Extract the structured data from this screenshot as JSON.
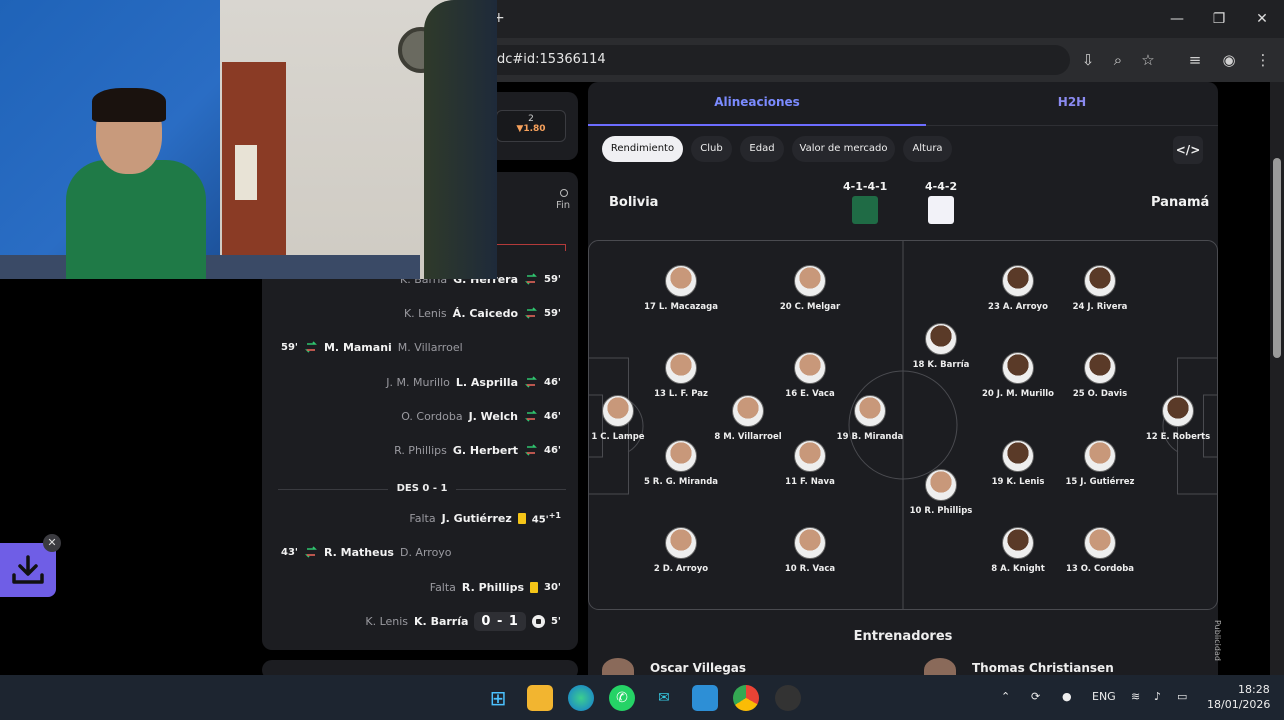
{
  "browser": {
    "url": "dc#id:15366114",
    "window_controls": [
      "minimize-icon",
      "maximize-icon",
      "close-icon"
    ],
    "new_tab": "+"
  },
  "match": {
    "odds_label": "2",
    "odds_value": "▼1.80",
    "fin_label": "Fin",
    "halftime_label": "DES 0 - 1",
    "score": "0 - 1"
  },
  "timeline": [
    {
      "side": "right",
      "secondary": "K. Barría",
      "main": "G. Herrera",
      "type": "sub",
      "minute": "59'"
    },
    {
      "side": "right",
      "secondary": "K. Lenis",
      "main": "Á. Caicedo",
      "type": "sub",
      "minute": "59'"
    },
    {
      "side": "left",
      "secondary": "M. Villarroel",
      "main": "M. Mamani",
      "type": "sub",
      "minute": "59'"
    },
    {
      "side": "right",
      "secondary": "J. M. Murillo",
      "main": "L. Asprilla",
      "type": "sub",
      "minute": "46'"
    },
    {
      "side": "right",
      "secondary": "O. Cordoba",
      "main": "J. Welch",
      "type": "sub",
      "minute": "46'"
    },
    {
      "side": "right",
      "secondary": "R. Phillips",
      "main": "G. Herbert",
      "type": "sub",
      "minute": "46'"
    },
    {
      "side": "right",
      "secondary": "Falta",
      "main": "J. Gutiérrez",
      "type": "yellow",
      "minute": "45'",
      "added": "+1"
    },
    {
      "side": "left",
      "secondary": "D. Arroyo",
      "main": "R. Matheus",
      "type": "sub",
      "minute": "43'"
    },
    {
      "side": "right",
      "secondary": "Falta",
      "main": "R. Phillips",
      "type": "yellow",
      "minute": "30'"
    },
    {
      "side": "right",
      "secondary": "K. Lenis",
      "main": "K. Barría",
      "type": "goal",
      "minute": "5'"
    }
  ],
  "lineup": {
    "tabs": [
      "Alineaciones",
      "H2H"
    ],
    "filters": [
      "Rendimiento",
      "Club",
      "Edad",
      "Valor de mercado",
      "Altura"
    ],
    "embed_icon": "</>",
    "home": {
      "name": "Bolivia",
      "formation": "4-1-4-1",
      "kit_color": "#1f6b45"
    },
    "away": {
      "name": "Panamá",
      "formation": "4-4-2",
      "kit_color": "#f2f2f8"
    },
    "home_players": [
      {
        "label": "1 C. Lampe"
      },
      {
        "label": "17 L. Macazaga"
      },
      {
        "label": "13 L. F. Paz"
      },
      {
        "label": "5 R. G. Miranda"
      },
      {
        "label": "2 D. Arroyo"
      },
      {
        "label": "8 M. Villarroel"
      },
      {
        "label": "20 C. Melgar"
      },
      {
        "label": "16 E. Vaca"
      },
      {
        "label": "11 F. Nava"
      },
      {
        "label": "10 R. Vaca"
      },
      {
        "label": "19 B. Miranda"
      }
    ],
    "away_players": [
      {
        "label": "18 K. Barría"
      },
      {
        "label": "10 R. Phillips"
      },
      {
        "label": "23 A. Arroyo"
      },
      {
        "label": "20 J. M. Murillo"
      },
      {
        "label": "19 K. Lenis"
      },
      {
        "label": "8 A. Knight"
      },
      {
        "label": "24 J. Rivera"
      },
      {
        "label": "25 O. Davis"
      },
      {
        "label": "15 J. Gutiérrez"
      },
      {
        "label": "13 O. Cordoba"
      },
      {
        "label": "12 E. Roberts"
      }
    ],
    "coaches_title": "Entrenadores",
    "coaches": [
      "Oscar Villegas",
      "Thomas Christiansen"
    ],
    "ad_label": "Publicidad"
  },
  "taskbar": {
    "apps": [
      "windows-start-icon",
      "file-explorer-icon",
      "edge-icon",
      "whatsapp-icon",
      "mail-icon",
      "photos-icon",
      "chrome-icon",
      "app-icon"
    ],
    "language": "ENG",
    "time": "18:28",
    "date": "18/01/2026"
  }
}
